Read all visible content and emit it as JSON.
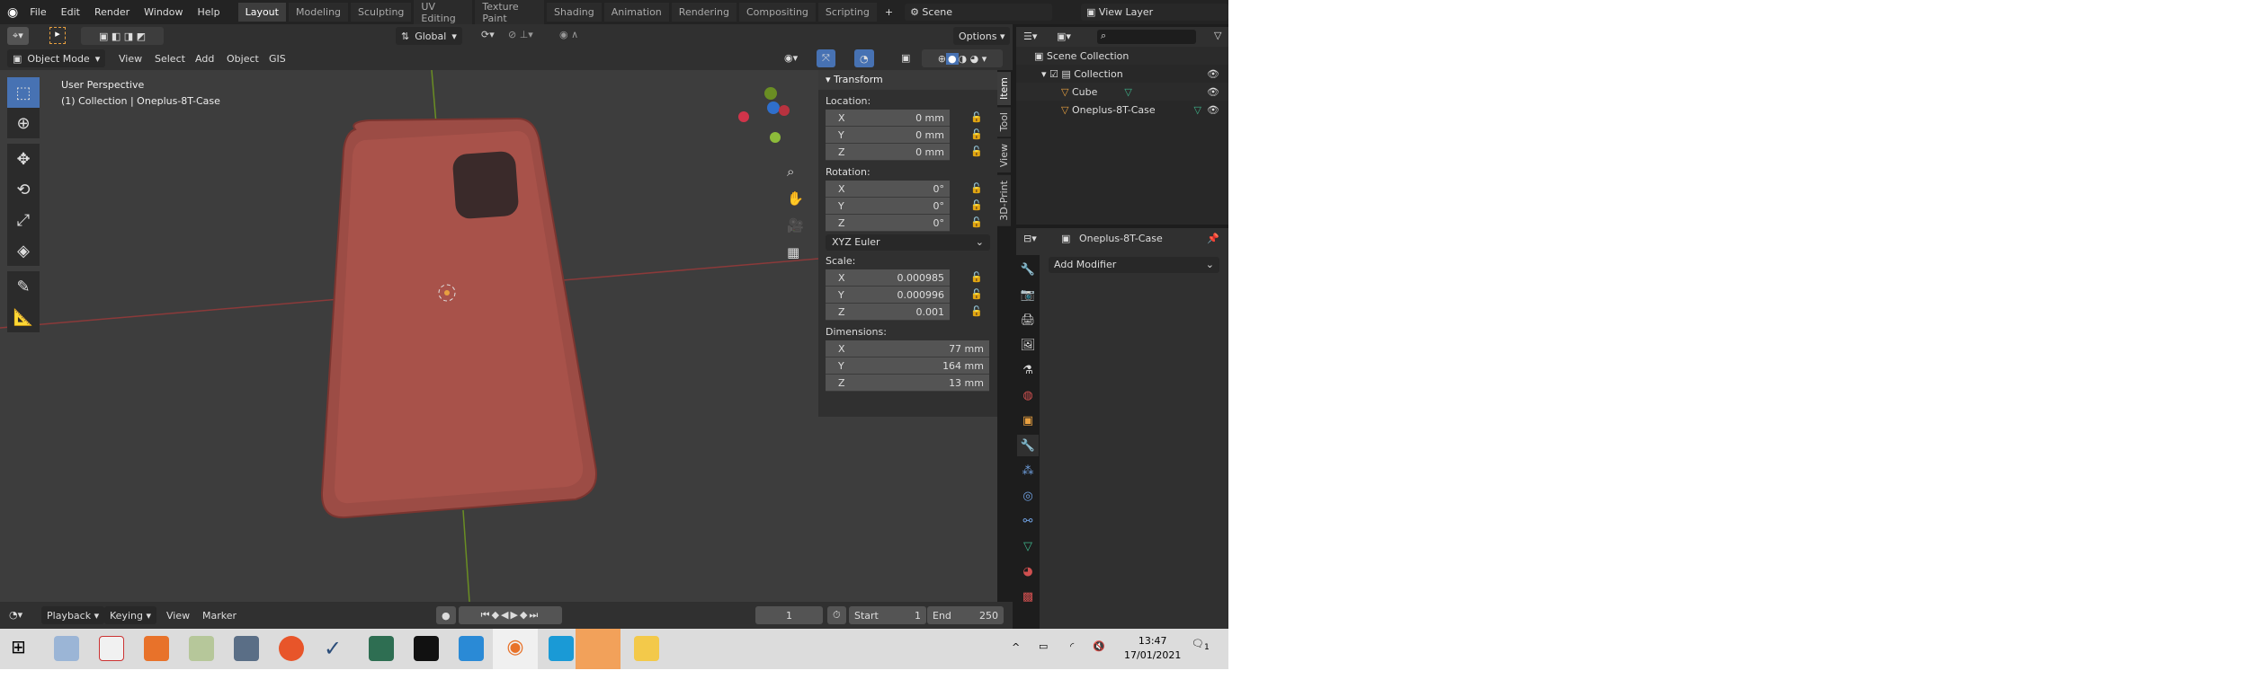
{
  "menu": [
    "File",
    "Edit",
    "Render",
    "Window",
    "Help"
  ],
  "workspaces": [
    "Layout",
    "Modeling",
    "Sculpting",
    "UV Editing",
    "Texture Paint",
    "Shading",
    "Animation",
    "Rendering",
    "Compositing",
    "Scripting",
    "+"
  ],
  "scene": "Scene",
  "view_layer": "View Layer",
  "tool_header": {
    "orientation": "Global",
    "options": "Options"
  },
  "viewport_header": {
    "mode": "Object Mode",
    "menus": [
      "View",
      "Select",
      "Add",
      "Object",
      "GIS"
    ]
  },
  "overlay": {
    "line1": "User Perspective",
    "line2": "(1) Collection | Oneplus-8T-Case"
  },
  "npanel": {
    "title": "Transform",
    "location_label": "Location:",
    "location": [
      [
        "X",
        "0 mm"
      ],
      [
        "Y",
        "0 mm"
      ],
      [
        "Z",
        "0 mm"
      ]
    ],
    "rotation_label": "Rotation:",
    "rotation": [
      [
        "X",
        "0°"
      ],
      [
        "Y",
        "0°"
      ],
      [
        "Z",
        "0°"
      ]
    ],
    "rotation_mode": "XYZ Euler",
    "scale_label": "Scale:",
    "scale": [
      [
        "X",
        "0.000985"
      ],
      [
        "Y",
        "0.000996"
      ],
      [
        "Z",
        "0.001"
      ]
    ],
    "dimensions_label": "Dimensions:",
    "dimensions": [
      [
        "X",
        "77 mm"
      ],
      [
        "Y",
        "164 mm"
      ],
      [
        "Z",
        "13 mm"
      ]
    ],
    "tabs": [
      "Item",
      "Tool",
      "View",
      "3D-Print"
    ]
  },
  "outliner": {
    "root": "Scene Collection",
    "collection": "Collection",
    "items": [
      "Cube",
      "Oneplus-8T-Case"
    ]
  },
  "properties": {
    "object": "Oneplus-8T-Case",
    "add_modifier": "Add Modifier"
  },
  "timeline": {
    "menus": [
      "Playback",
      "Keying",
      "View",
      "Marker"
    ],
    "current_frame": "1",
    "start_label": "Start",
    "start": "1",
    "end_label": "End",
    "end": "250"
  },
  "taskbar": {
    "time": "13:47",
    "date": "17/01/2021",
    "notifications": "1"
  },
  "colors": {
    "accent": "#4772b3",
    "case": "#a8524a",
    "x_axis": "#8b3a3a",
    "y_axis": "#6a8e23"
  }
}
